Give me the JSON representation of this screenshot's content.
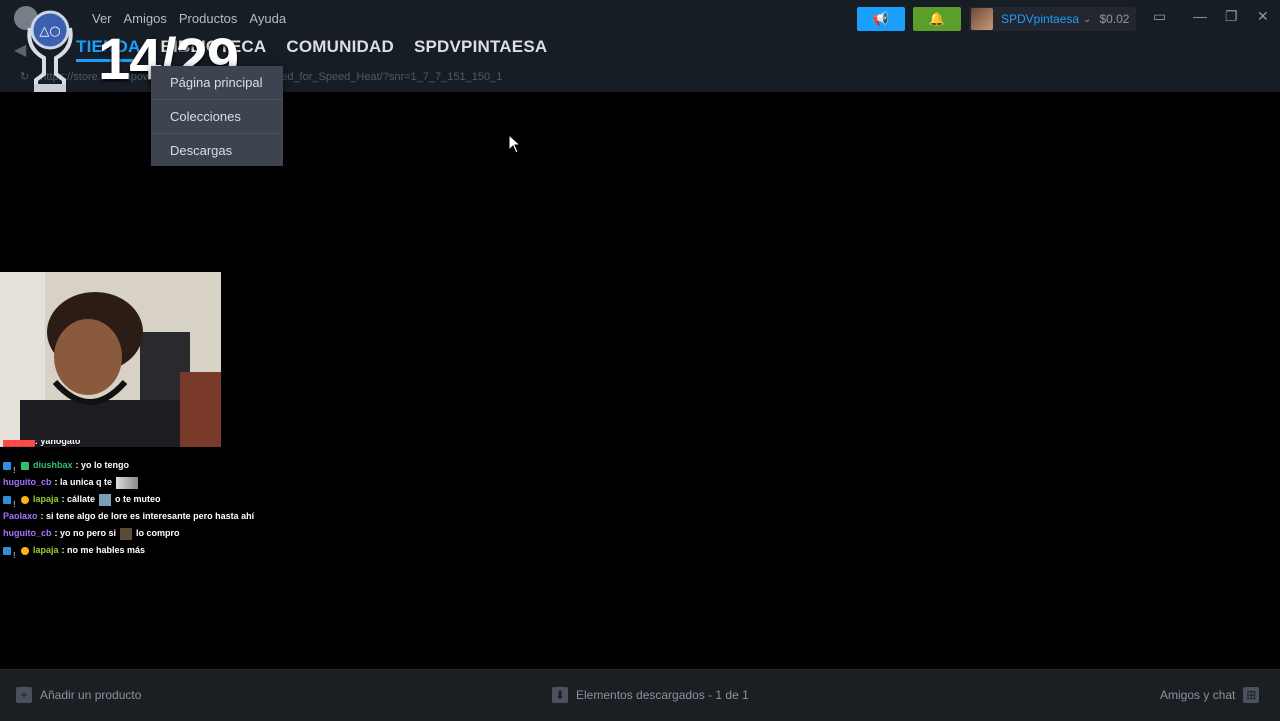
{
  "menu": {
    "items": [
      "Ver",
      "Amigos",
      "Productos",
      "Ayuda"
    ]
  },
  "nav": {
    "tabs": [
      {
        "label": "TIENDA",
        "active": true
      },
      {
        "label": "BIBLIOTECA",
        "active": false
      },
      {
        "label": "COMUNIDAD",
        "active": false
      },
      {
        "label": "SPDVPINTAESA",
        "active": false
      }
    ],
    "back_icon": "back-arrow-icon"
  },
  "url": {
    "text": "https://store.steampowered.com/app/1222680/Need_for_Speed_Heat/?snr=1_7_7_151_150_1"
  },
  "header": {
    "announce_icon": "megaphone-icon",
    "notify_icon": "bell-icon",
    "account_name": "SPDVpintaesa",
    "balance": "$0.02",
    "colors": {
      "accent": "#1a9fff",
      "notify": "#5c9e2b",
      "titlebar": "#171d25"
    }
  },
  "overlay": {
    "counter": "14/29",
    "icon": "playstation-trophy-icon"
  },
  "dropdown": {
    "items": [
      "Página principal",
      "Colecciones",
      "Descargas"
    ]
  },
  "chat": {
    "messages": [
      {
        "user": "",
        "user_color": "#ff4a4a",
        "text": ": yahogato",
        "badges": [],
        "partial": true
      },
      {
        "user": "diushbax",
        "user_color": "#2fbf71",
        "text": ": yo lo tengo",
        "badges": [
          "prime",
          "key",
          "green"
        ]
      },
      {
        "user": "huguito_cb",
        "user_color": "#a970ff",
        "text": ": la unica q te",
        "badges": [],
        "emote": "wide"
      },
      {
        "user": "lapaja",
        "user_color": "#9acd32",
        "text": ": cállate",
        "badges": [
          "prime",
          "key",
          "orange"
        ],
        "emote": "small",
        "after": "o te muteo"
      },
      {
        "user": "Paolaxo",
        "user_color": "#a970ff",
        "text": ": si tene algo de lore es interesante pero hasta ahí",
        "badges": []
      },
      {
        "user": "huguito_cb",
        "user_color": "#a970ff",
        "text": ": yo no pero si",
        "badges": [],
        "emote": "face",
        "after": "lo compro"
      },
      {
        "user": "lapaja",
        "user_color": "#9acd32",
        "text": ": no me hables más",
        "badges": [
          "prime",
          "key",
          "orange"
        ]
      }
    ]
  },
  "footer": {
    "add_product": "Añadir un producto",
    "downloads": "Elementos descargados - 1 de 1",
    "friends": "Amigos y chat"
  }
}
